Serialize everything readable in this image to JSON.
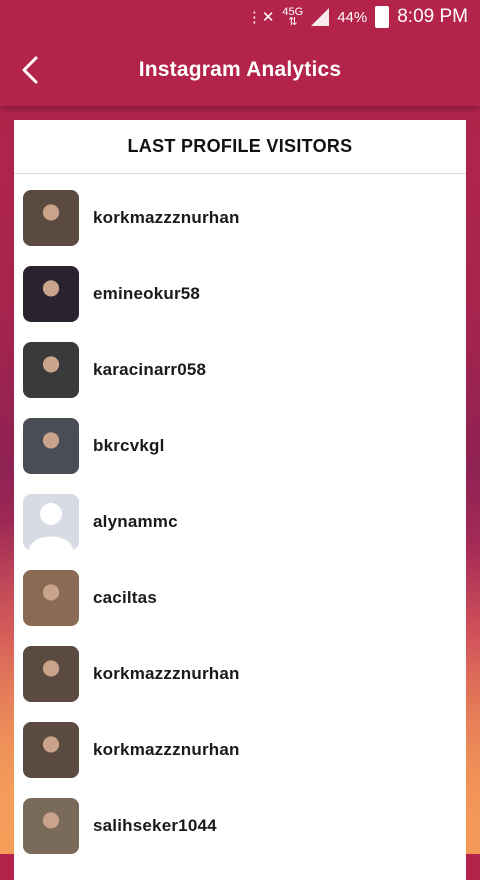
{
  "status_bar": {
    "network_type": "4G",
    "network_sub": "45G",
    "battery": "44%",
    "time": "8:09 PM"
  },
  "appbar": {
    "title": "Instagram Analytics",
    "back_icon": "chevron-left-icon"
  },
  "card": {
    "header": "LAST PROFILE VISITORS",
    "visitors": [
      {
        "username": "korkmazzznurhan",
        "avatar_color": "#5a4a40"
      },
      {
        "username": "emineokur58",
        "avatar_color": "#2b2230"
      },
      {
        "username": "karacinarr058",
        "avatar_color": "#3a3a3a"
      },
      {
        "username": "bkrcvkgl",
        "avatar_color": "#4a4d55"
      },
      {
        "username": "alynammc",
        "avatar_color": "#d7dbe3"
      },
      {
        "username": "caciltas",
        "avatar_color": "#8a6a55"
      },
      {
        "username": "korkmazzznurhan",
        "avatar_color": "#5a4a40"
      },
      {
        "username": "korkmazzznurhan",
        "avatar_color": "#5a4a40"
      },
      {
        "username": "salihseker1044",
        "avatar_color": "#7a6a5a"
      }
    ]
  }
}
